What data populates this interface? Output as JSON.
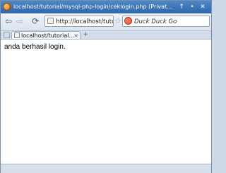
{
  "window": {
    "title": "localhost/tutorial/mysql-php-login/ceklogin.php (Private Browsing)"
  },
  "toolbar": {
    "url": "http://localhost/tutorial",
    "search_placeholder": "Duck Duck Go"
  },
  "tabs": [
    {
      "label": "localhost/tutorial..."
    }
  ],
  "page": {
    "message": "anda berhasil login."
  },
  "icons": {
    "up": "↑",
    "min": "•",
    "close": "✕",
    "back": "⇦",
    "forward": "⇨",
    "reload": "⟳",
    "star": "☆",
    "tab_close": "×",
    "new_tab": "+"
  }
}
